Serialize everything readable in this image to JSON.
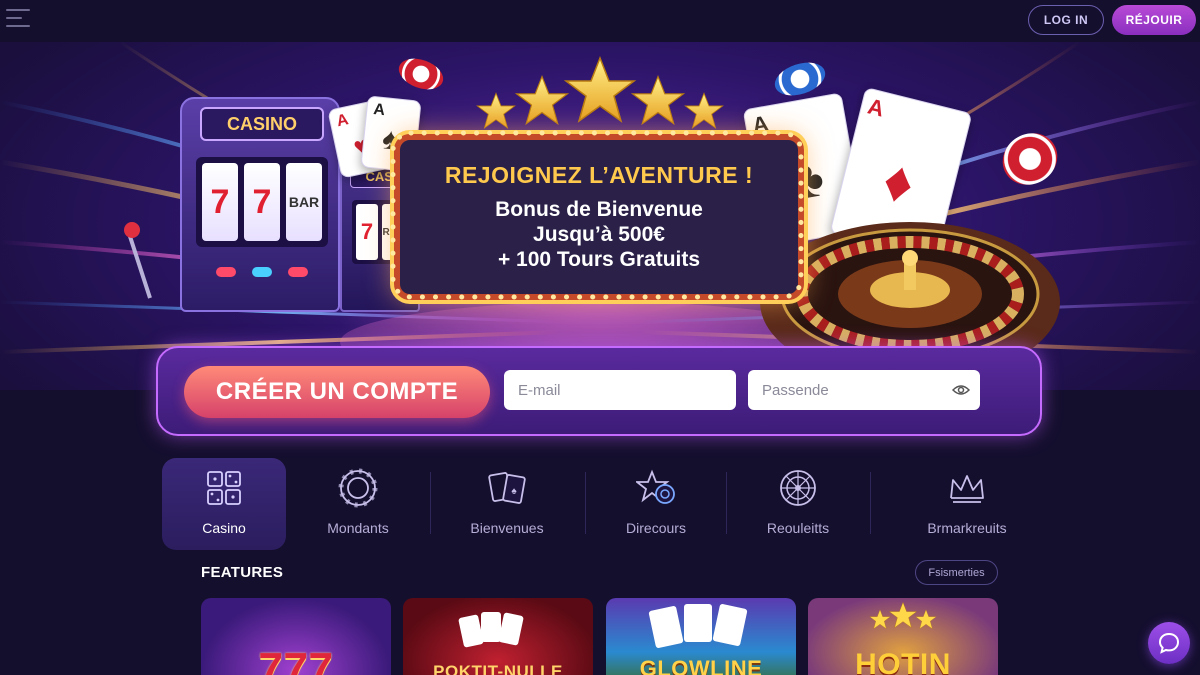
{
  "header": {
    "login_label": "LOG IN",
    "join_label": "RÉJOUIR"
  },
  "hero": {
    "slot_sign": "CASINO",
    "slot_sign_2": "CASI",
    "reel_symbol": "7",
    "reel_bar": "BAR",
    "reel_bar_2": "RAP",
    "headline": "REJOIGNEZ L’AVENTURE !",
    "bonus_line1": "Bonus de Bienvenue",
    "bonus_line2": "Jusqu’à 500€",
    "bonus_line3": "+ 100 Tours Gratuits",
    "card_rank": "A"
  },
  "signup": {
    "create_label": "CRÉER UN COMPTE",
    "email_placeholder": "E-mail",
    "password_placeholder": "Passende"
  },
  "categories": [
    {
      "label": "Casino",
      "icon": "dice-grid-icon",
      "active": true
    },
    {
      "label": "Mondants",
      "icon": "chip-icon"
    },
    {
      "label": "Bienvenues",
      "icon": "cards-icon"
    },
    {
      "label": "Direcours",
      "icon": "star-chip-icon"
    },
    {
      "label": "Reouleitts",
      "icon": "roulette-icon"
    },
    {
      "label": "Brmarkreuits",
      "icon": "crown-icon"
    }
  ],
  "features": {
    "title": "FEATURES",
    "button_label": "Fsismerties",
    "tiles": [
      {
        "name": "777",
        "color": "#e0263a"
      },
      {
        "name": "POKTIT-NULLE",
        "color": "#ffd46a"
      },
      {
        "name": "GLOWLINE",
        "color": "#ffd24a"
      },
      {
        "name": "HOTIN",
        "color": "#ffcf3a"
      }
    ]
  },
  "colors": {
    "accent": "#b84ad6",
    "background": "#150f2e",
    "cta": "#d6426a"
  }
}
